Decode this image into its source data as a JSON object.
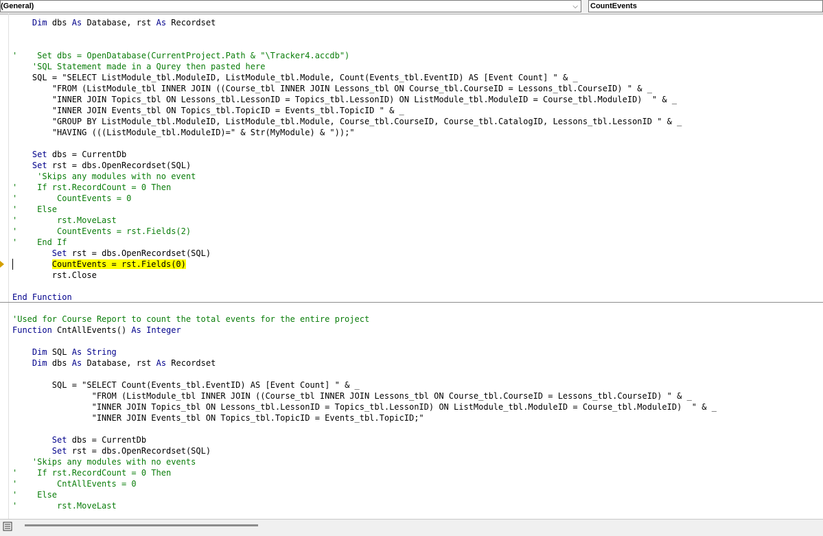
{
  "toolbar": {
    "object_combo": "(General)",
    "procedure_combo": "CountEvents",
    "dropdown_glyph": "⌵"
  },
  "code": {
    "lines": [
      {
        "text": "    Dim dbs As Database, rst As Recordset"
      },
      {
        "text": ""
      },
      {
        "text": ""
      },
      {
        "gutter": "'",
        "text": "     Set dbs = OpenDatabase(CurrentProject.Path & \"\\Tracker4.accdb\")",
        "comment": true
      },
      {
        "text": "    'SQL Statement made in a Qurey then pasted here",
        "comment": true
      },
      {
        "text": "    SQL = \"SELECT ListModule_tbl.ModuleID, ListModule_tbl.Module, Count(Events_tbl.EventID) AS [Event Count] \" & _"
      },
      {
        "text": "        \"FROM (ListModule_tbl INNER JOIN ((Course_tbl INNER JOIN Lessons_tbl ON Course_tbl.CourseID = Lessons_tbl.CourseID) \" & _"
      },
      {
        "text": "        \"INNER JOIN Topics_tbl ON Lessons_tbl.LessonID = Topics_tbl.LessonID) ON ListModule_tbl.ModuleID = Course_tbl.ModuleID)  \" & _"
      },
      {
        "text": "        \"INNER JOIN Events_tbl ON Topics_tbl.TopicID = Events_tbl.TopicID \" & _"
      },
      {
        "text": "        \"GROUP BY ListModule_tbl.ModuleID, ListModule_tbl.Module, Course_tbl.CourseID, Course_tbl.CatalogID, Lessons_tbl.LessonID \" & _"
      },
      {
        "text": "        \"HAVING (((ListModule_tbl.ModuleID)=\" & Str(MyModule) & \"));\""
      },
      {
        "text": ""
      },
      {
        "text": "    Set dbs = CurrentDb"
      },
      {
        "text": "    Set rst = dbs.OpenRecordset(SQL)"
      },
      {
        "text": "     'Skips any modules with no event",
        "comment": true
      },
      {
        "gutter": "'",
        "text": "     If rst.RecordCount = 0 Then",
        "comment": true
      },
      {
        "gutter": "'",
        "text": "         CountEvents = 0",
        "comment": true
      },
      {
        "gutter": "'",
        "text": "     Else",
        "comment": true
      },
      {
        "gutter": "'",
        "text": "         rst.MoveLast",
        "comment": true
      },
      {
        "gutter": "'",
        "text": "         CountEvents = rst.Fields(2)",
        "comment": true
      },
      {
        "gutter": "'",
        "text": "     End If",
        "comment": true
      },
      {
        "text": "        Set rst = dbs.OpenRecordset(SQL)"
      },
      {
        "text": "        CountEvents = rst.Fields(0)",
        "highlight": true
      },
      {
        "text": "        rst.Close"
      },
      {
        "text": ""
      },
      {
        "text": "End Function"
      },
      {
        "text": ""
      },
      {
        "text": "'Used for Course Report to count the total events for the entire project",
        "comment": true
      },
      {
        "text": "Function CntAllEvents() As Integer"
      },
      {
        "text": ""
      },
      {
        "text": "    Dim SQL As String"
      },
      {
        "text": "    Dim dbs As Database, rst As Recordset"
      },
      {
        "text": ""
      },
      {
        "text": "        SQL = \"SELECT Count(Events_tbl.EventID) AS [Event Count] \" & _"
      },
      {
        "text": "                \"FROM (ListModule_tbl INNER JOIN ((Course_tbl INNER JOIN Lessons_tbl ON Course_tbl.CourseID = Lessons_tbl.CourseID) \" & _"
      },
      {
        "text": "                \"INNER JOIN Topics_tbl ON Lessons_tbl.LessonID = Topics_tbl.LessonID) ON ListModule_tbl.ModuleID = Course_tbl.ModuleID)  \" & _"
      },
      {
        "text": "                \"INNER JOIN Events_tbl ON Topics_tbl.TopicID = Events_tbl.TopicID;\""
      },
      {
        "text": ""
      },
      {
        "text": "        Set dbs = CurrentDb"
      },
      {
        "text": "        Set rst = dbs.OpenRecordset(SQL)"
      },
      {
        "text": "    'Skips any modules with no events",
        "comment": true
      },
      {
        "gutter": "'",
        "text": "     If rst.RecordCount = 0 Then",
        "comment": true
      },
      {
        "gutter": "'",
        "text": "         CntAllEvents = 0",
        "comment": true
      },
      {
        "gutter": "'",
        "text": "     Else",
        "comment": true
      },
      {
        "gutter": "'",
        "text": "         rst.MoveLast",
        "comment": true
      }
    ]
  },
  "colors": {
    "keyword": "#00008b",
    "comment": "#0a7d0a",
    "highlight": "#ffff00",
    "execution_arrow": "#d4a000"
  },
  "icons": [
    "dropdown-chevron-icon",
    "execution-point-arrow-icon",
    "full-module-view-icon"
  ]
}
